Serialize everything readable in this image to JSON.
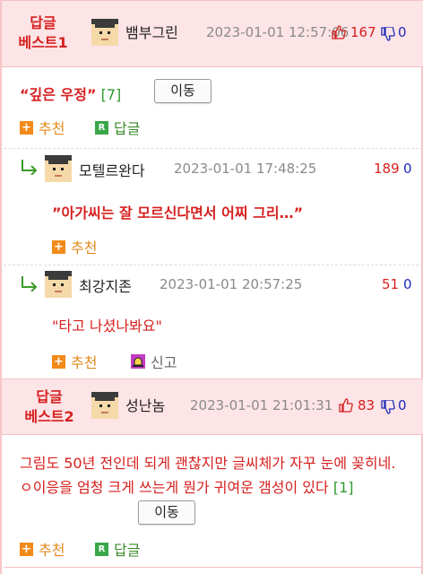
{
  "comments": [
    {
      "best_label_1": "답글",
      "best_label_2": "베스트1",
      "username": "뱀부그린",
      "date": "2023-01-01 12:57:06",
      "up": "167",
      "down": "0",
      "quote": "“깊은 우정”",
      "reply_count": "[7]",
      "move_label": "이동",
      "recommend_label": "추천",
      "reply_label": "답글"
    },
    {
      "best_label_1": "답글",
      "best_label_2": "베스트2",
      "username": "성난놈",
      "date": "2023-01-01 21:01:31",
      "up": "83",
      "down": "0",
      "text": "그림도 50년 전인데 되게 괜찮지만 글씨체가 자꾸 눈에 꽂히네. ㅇ이응을 엄청 크게 쓰는게 뭔가 귀여운 갬성이 있다",
      "reply_count": "[1]",
      "move_label": "이동",
      "recommend_label": "추천",
      "reply_label": "답글"
    }
  ],
  "replies": [
    {
      "username": "모텔르완다",
      "date": "2023-01-01 17:48:25",
      "up": "189",
      "down": "0",
      "text": "”아가씨는 잘 모르신다면서 어찌 그리…”",
      "recommend_label": "추천"
    },
    {
      "username": "최강지존",
      "date": "2023-01-01 20:57:25",
      "up": "51",
      "down": "0",
      "text": "\"타고 나셨나봐요\"",
      "recommend_label": "추천",
      "report_label": "신고"
    }
  ],
  "colors": {
    "accent_red": "#d6201f",
    "best_bg": "#fde4e6",
    "recommend_orange": "#f28a1a",
    "reply_green": "#3aa84a",
    "down_blue": "#1f2ab8"
  }
}
